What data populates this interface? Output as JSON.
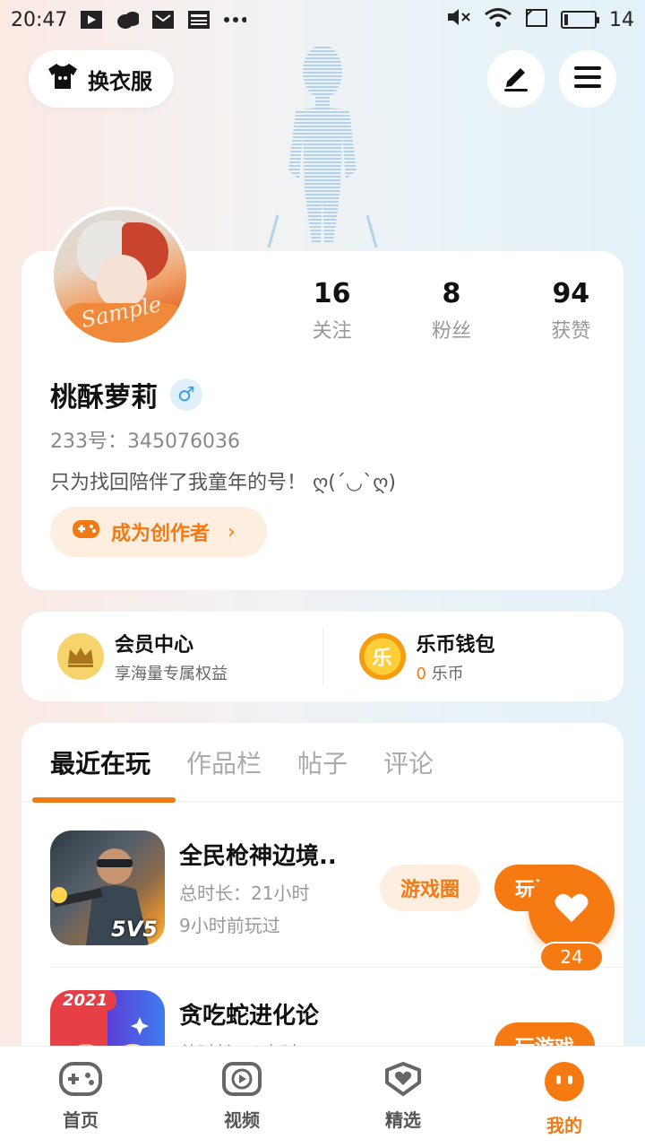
{
  "status_bar": {
    "time": "20:47",
    "battery": "14",
    "battery_level": 0.14,
    "left_icons": [
      "play-icon",
      "cloud-icon",
      "mail-icon",
      "news-icon",
      "more-dots-icon"
    ],
    "right_icons": [
      "mute-icon",
      "wifi-icon",
      "sim-icon",
      "battery-icon"
    ]
  },
  "header": {
    "outfit_label": "换衣服"
  },
  "profile": {
    "avatar_watermark": "Sample",
    "stats": [
      {
        "value": "16",
        "label": "关注"
      },
      {
        "value": "8",
        "label": "粉丝"
      },
      {
        "value": "94",
        "label": "获赞"
      }
    ],
    "username": "桃酥萝莉",
    "gender_symbol": "♂",
    "uid": "233号：345076036",
    "bio": "只为找回陪伴了我童年的号！ ღ(ˊ◡ˋღ)",
    "creator_label": "成为创作者",
    "creator_chevron": "›"
  },
  "membership": {
    "vip_title": "会员中心",
    "vip_sub": "享海量专属权益",
    "wallet_title": "乐币钱包",
    "wallet_amount": "0",
    "wallet_unit": "乐币",
    "wallet_icon_char": "乐"
  },
  "tabs": [
    {
      "label": "最近在玩",
      "active": true
    },
    {
      "label": "作品栏",
      "active": false
    },
    {
      "label": "帖子",
      "active": false
    },
    {
      "label": "评论",
      "active": false
    }
  ],
  "games": [
    {
      "name": "全民枪神边境..",
      "duration": "总时长：21小时",
      "last_played": "9小时前玩过",
      "circle_label": "游戏圈",
      "play_label": "玩游戏",
      "icon_badge": "5V5"
    },
    {
      "name": "贪吃蛇进化论",
      "duration": "总时长：2小时",
      "play_label": "玩游戏",
      "icon_badge": "2021"
    }
  ],
  "fab": {
    "count": "24"
  },
  "bottom_nav": [
    {
      "label": "首页",
      "icon": "gamepad-icon",
      "active": false
    },
    {
      "label": "视频",
      "icon": "video-play-icon",
      "active": false
    },
    {
      "label": "精选",
      "icon": "heart-badge-icon",
      "active": false
    },
    {
      "label": "我的",
      "icon": "profile-face-icon",
      "active": true
    }
  ],
  "colors": {
    "accent": "#f57a12",
    "accent_text": "#f07b16",
    "accent_light": "#fdeee0"
  }
}
